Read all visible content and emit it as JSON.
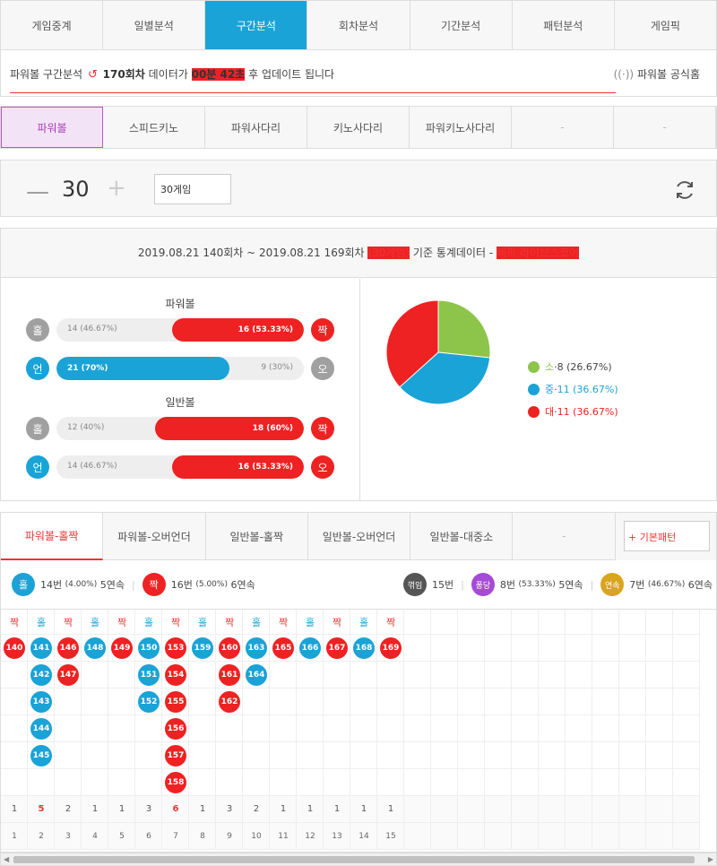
{
  "top_tabs": [
    {
      "label": "게임중계"
    },
    {
      "label": "일별분석"
    },
    {
      "label": "구간분석",
      "active": true
    },
    {
      "label": "회차분석"
    },
    {
      "label": "기간분석"
    },
    {
      "label": "패턴분석"
    },
    {
      "label": "게임픽"
    }
  ],
  "info": {
    "prefix": "파워볼 구간분석",
    "round": "170회차",
    "text1": "데이터가",
    "time": "00분 42초",
    "text2": "후 업데이트 됩니다",
    "official": "파워볼 공식홈"
  },
  "sub_tabs": [
    {
      "label": "파워볼",
      "active": true
    },
    {
      "label": "스피드키노"
    },
    {
      "label": "파워사다리"
    },
    {
      "label": "키노사다리"
    },
    {
      "label": "파워키노사다리"
    },
    {
      "label": "-"
    },
    {
      "label": "-"
    }
  ],
  "control": {
    "minus": "—",
    "count": "30",
    "plus": "+",
    "select": "30게임"
  },
  "stats": {
    "range": "2019.08.21 140회차 ~ 2019.08.21 169회차",
    "games": "(30게임)",
    "tail": "기준 통계데이터 -",
    "brand": "베픽 라이브스코어",
    "powerball_title": "파워볼",
    "normal_title": "일반볼",
    "rows": [
      {
        "left_icon": "홀",
        "left_text": "14 (46.67%)",
        "right_text": "16 (53.33%)",
        "right_icon": "짝",
        "fill": 0.5333,
        "side": "right"
      },
      {
        "left_icon": "언",
        "left_text": "21 (70%)",
        "right_text": "9 (30%)",
        "right_icon": "오",
        "fill": 0.7,
        "side": "left"
      },
      {
        "left_icon": "홀",
        "left_text": "12 (40%)",
        "right_text": "18 (60%)",
        "right_icon": "짝",
        "fill": 0.6,
        "side": "right"
      },
      {
        "left_icon": "언",
        "left_text": "14 (46.67%)",
        "right_text": "16 (53.33%)",
        "right_icon": "오",
        "fill": 0.5333,
        "side": "right"
      }
    ],
    "colors": {
      "blue": "#1aa3d6",
      "red": "#e22",
      "green": "#8dc54b",
      "grey": "#a0a0a0"
    }
  },
  "chart_data": {
    "type": "pie",
    "categories": [
      "소",
      "중",
      "대"
    ],
    "values": [
      8,
      11,
      11
    ],
    "labels": [
      "8 (26.67%)",
      "11 (36.67%)",
      "11 (36.67%)"
    ],
    "colors": [
      "#8dc54b",
      "#1aa3d6",
      "#e22"
    ]
  },
  "pattern_tabs": [
    {
      "label": "파워볼-홀짝",
      "active": true
    },
    {
      "label": "파워볼-오버언더"
    },
    {
      "label": "일반볼-홀짝"
    },
    {
      "label": "일반볼-오버언더"
    },
    {
      "label": "일반볼-대중소"
    },
    {
      "label": "-"
    }
  ],
  "basic_pattern": "+ 기본패턴",
  "summary": {
    "odd": {
      "icon": "홀",
      "count": "14번",
      "pct": "(4.00%)",
      "streak": "5연속"
    },
    "even": {
      "icon": "짝",
      "count": "16번",
      "pct": "(5.00%)",
      "streak": "6연속"
    },
    "break": {
      "icon": "꺾임",
      "count": "15번"
    },
    "pong": {
      "icon": "퐁당",
      "count": "8번",
      "pct": "(53.33%)",
      "streak": "5연속"
    },
    "cont": {
      "icon": "연속",
      "count": "7번",
      "pct": "(46.67%)",
      "streak": "6연속"
    }
  },
  "grid": {
    "columns": [
      {
        "head": "짝",
        "color": "red",
        "balls": [
          "140"
        ]
      },
      {
        "head": "홀",
        "color": "blue",
        "balls": [
          "141",
          "142",
          "143",
          "144",
          "145"
        ]
      },
      {
        "head": "짝",
        "color": "red",
        "balls": [
          "146",
          "147"
        ]
      },
      {
        "head": "홀",
        "color": "blue",
        "balls": [
          "148"
        ]
      },
      {
        "head": "짝",
        "color": "red",
        "balls": [
          "149"
        ]
      },
      {
        "head": "홀",
        "color": "blue",
        "balls": [
          "150",
          "151",
          "152"
        ]
      },
      {
        "head": "짝",
        "color": "red",
        "balls": [
          "153",
          "154",
          "155",
          "156",
          "157",
          "158"
        ]
      },
      {
        "head": "홀",
        "color": "blue",
        "balls": [
          "159"
        ]
      },
      {
        "head": "짝",
        "color": "red",
        "balls": [
          "160",
          "161",
          "162"
        ]
      },
      {
        "head": "홀",
        "color": "blue",
        "balls": [
          "163",
          "164"
        ]
      },
      {
        "head": "짝",
        "color": "red",
        "balls": [
          "165"
        ]
      },
      {
        "head": "홀",
        "color": "blue",
        "balls": [
          "166"
        ]
      },
      {
        "head": "짝",
        "color": "red",
        "balls": [
          "167"
        ]
      },
      {
        "head": "홀",
        "color": "blue",
        "balls": [
          "168"
        ]
      },
      {
        "head": "짝",
        "color": "red",
        "balls": [
          "169"
        ]
      }
    ],
    "counts": [
      "1",
      "5",
      "2",
      "1",
      "1",
      "3",
      "6",
      "1",
      "3",
      "2",
      "1",
      "1",
      "1",
      "1",
      "1"
    ],
    "highlight": [
      "5",
      "6"
    ],
    "indexes": [
      "1",
      "2",
      "3",
      "4",
      "5",
      "6",
      "7",
      "8",
      "9",
      "10",
      "11",
      "12",
      "13",
      "14",
      "15"
    ]
  }
}
